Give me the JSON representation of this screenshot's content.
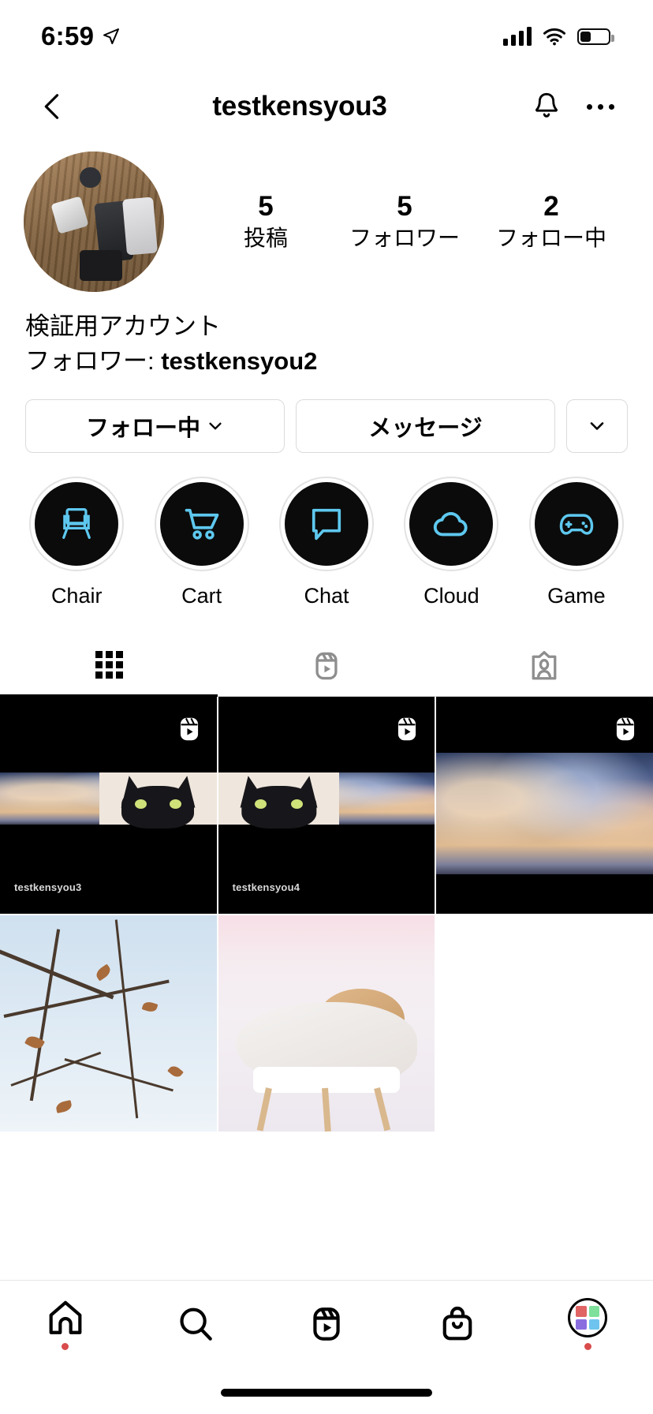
{
  "status_bar": {
    "time": "6:59",
    "location_icon": "location-arrow-icon",
    "signal_icon": "cellular-signal-icon",
    "wifi_icon": "wifi-icon",
    "battery_icon": "battery-icon"
  },
  "header": {
    "back_icon": "chevron-left-icon",
    "title": "testkensyou3",
    "notify_icon": "bell-icon",
    "more_icon": "ellipsis-icon"
  },
  "profile": {
    "avatar_alt": "profile-photo",
    "stats": [
      {
        "num": "5",
        "label": "投稿"
      },
      {
        "num": "5",
        "label": "フォロワー"
      },
      {
        "num": "2",
        "label": "フォロー中"
      }
    ],
    "display_name": "検証用アカウント",
    "followed_by_prefix": "フォロワー: ",
    "followed_by_user": "testkensyou2"
  },
  "actions": {
    "follow_label": "フォロー中",
    "message_label": "メッセージ",
    "more_caret_icon": "chevron-down-icon"
  },
  "highlights": [
    {
      "label": "Chair",
      "icon": "chair-icon"
    },
    {
      "label": "Cart",
      "icon": "shopping-cart-icon"
    },
    {
      "label": "Chat",
      "icon": "chat-bubble-icon"
    },
    {
      "label": "Cloud",
      "icon": "cloud-icon"
    },
    {
      "label": "Game",
      "icon": "game-controller-icon"
    }
  ],
  "tabs": [
    {
      "name": "grid",
      "icon": "grid-icon",
      "active": true
    },
    {
      "name": "reels",
      "icon": "reels-icon",
      "active": false
    },
    {
      "name": "tagged",
      "icon": "tagged-icon",
      "active": false
    }
  ],
  "posts": [
    {
      "type": "reel",
      "badge_icon": "reels-icon",
      "watermark": "testkensyou3"
    },
    {
      "type": "reel",
      "badge_icon": "reels-icon",
      "watermark": "testkensyou4"
    },
    {
      "type": "reel",
      "badge_icon": "reels-icon",
      "watermark": ""
    },
    {
      "type": "photo",
      "badge_icon": "",
      "watermark": ""
    },
    {
      "type": "photo",
      "badge_icon": "",
      "watermark": ""
    }
  ],
  "bottom_nav": [
    {
      "name": "home",
      "icon": "home-icon",
      "badge": true
    },
    {
      "name": "search",
      "icon": "search-icon",
      "badge": false
    },
    {
      "name": "reels",
      "icon": "reels-icon",
      "badge": false
    },
    {
      "name": "shop",
      "icon": "shopping-bag-icon",
      "badge": false
    },
    {
      "name": "profile",
      "icon": "profile-avatar-icon",
      "badge": true
    }
  ],
  "colors": {
    "highlight_icon": "#5ec8ef",
    "badge_dot": "#d94c4c",
    "border": "#dbdbdb",
    "inactive_tab": "#8e8e8e"
  }
}
